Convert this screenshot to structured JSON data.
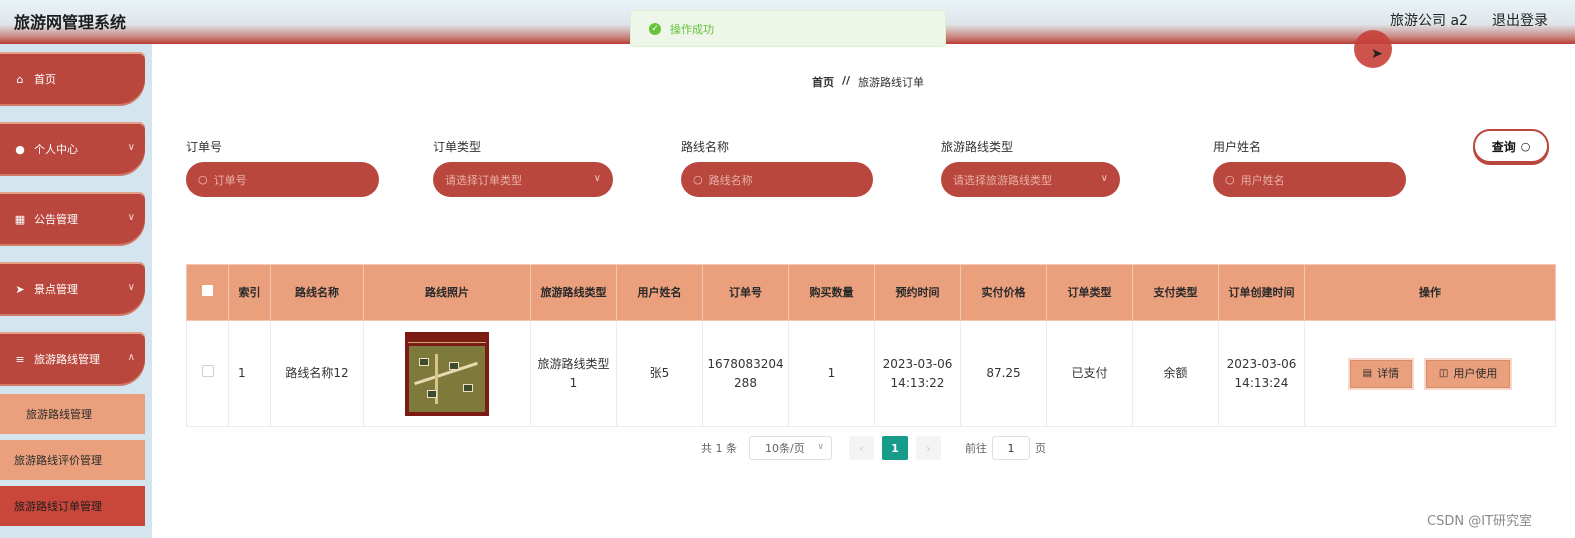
{
  "header": {
    "app_title": "旅游网管理系统",
    "user_name": "旅游公司 a2",
    "logout_label": "退出登录"
  },
  "toast": {
    "message": "操作成功"
  },
  "sidebar": {
    "items": [
      {
        "label": "首页",
        "icon": "home-icon",
        "expandable": false
      },
      {
        "label": "个人中心",
        "icon": "user-icon",
        "expandable": true
      },
      {
        "label": "公告管理",
        "icon": "grid-icon",
        "expandable": true
      },
      {
        "label": "景点管理",
        "icon": "send-icon",
        "expandable": true
      },
      {
        "label": "旅游路线管理",
        "icon": "list-icon",
        "expandable": true
      }
    ],
    "sub_items": [
      {
        "label": "旅游路线管理"
      },
      {
        "label": "旅游路线评价管理"
      },
      {
        "label": "旅游路线订单管理"
      }
    ]
  },
  "breadcrumb": {
    "home": "首页",
    "separator": "//",
    "current": "旅游路线订单"
  },
  "filters": {
    "order_no": {
      "label": "订单号",
      "placeholder": "订单号"
    },
    "order_type": {
      "label": "订单类型",
      "placeholder": "请选择订单类型"
    },
    "route_name": {
      "label": "路线名称",
      "placeholder": "路线名称"
    },
    "route_type": {
      "label": "旅游路线类型",
      "placeholder": "请选择旅游路线类型"
    },
    "user_name": {
      "label": "用户姓名",
      "placeholder": "用户姓名"
    },
    "query_label": "查询"
  },
  "table": {
    "headers": {
      "index": "索引",
      "route_name": "路线名称",
      "route_photo": "路线照片",
      "route_type": "旅游路线类型",
      "user_name": "用户姓名",
      "order_no": "订单号",
      "quantity": "购买数量",
      "booking_time": "预约时间",
      "paid_price": "实付价格",
      "order_type": "订单类型",
      "payment_type": "支付类型",
      "created_time": "订单创建时间",
      "actions": "操作"
    },
    "rows": [
      {
        "index": "1",
        "route_name": "路线名称12",
        "route_type": "旅游路线类型1",
        "user_name": "张5",
        "order_no": "1678083204288",
        "quantity": "1",
        "booking_time": "2023-03-06 14:13:22",
        "paid_price": "87.25",
        "order_type": "已支付",
        "payment_type": "余额",
        "created_time": "2023-03-06 14:13:24",
        "detail_label": "详情",
        "use_label": "用户使用"
      }
    ]
  },
  "pagination": {
    "total_text": "共 1 条",
    "page_size": "10条/页",
    "current_page": "1",
    "goto_prefix": "前往",
    "goto_value": "1",
    "goto_suffix": "页"
  },
  "watermark": "CSDN @IT研究室",
  "colors": {
    "accent": "#b9473e",
    "table_header": "#eaa07d",
    "pager_active": "#179b8a",
    "success": "#67c23a"
  }
}
